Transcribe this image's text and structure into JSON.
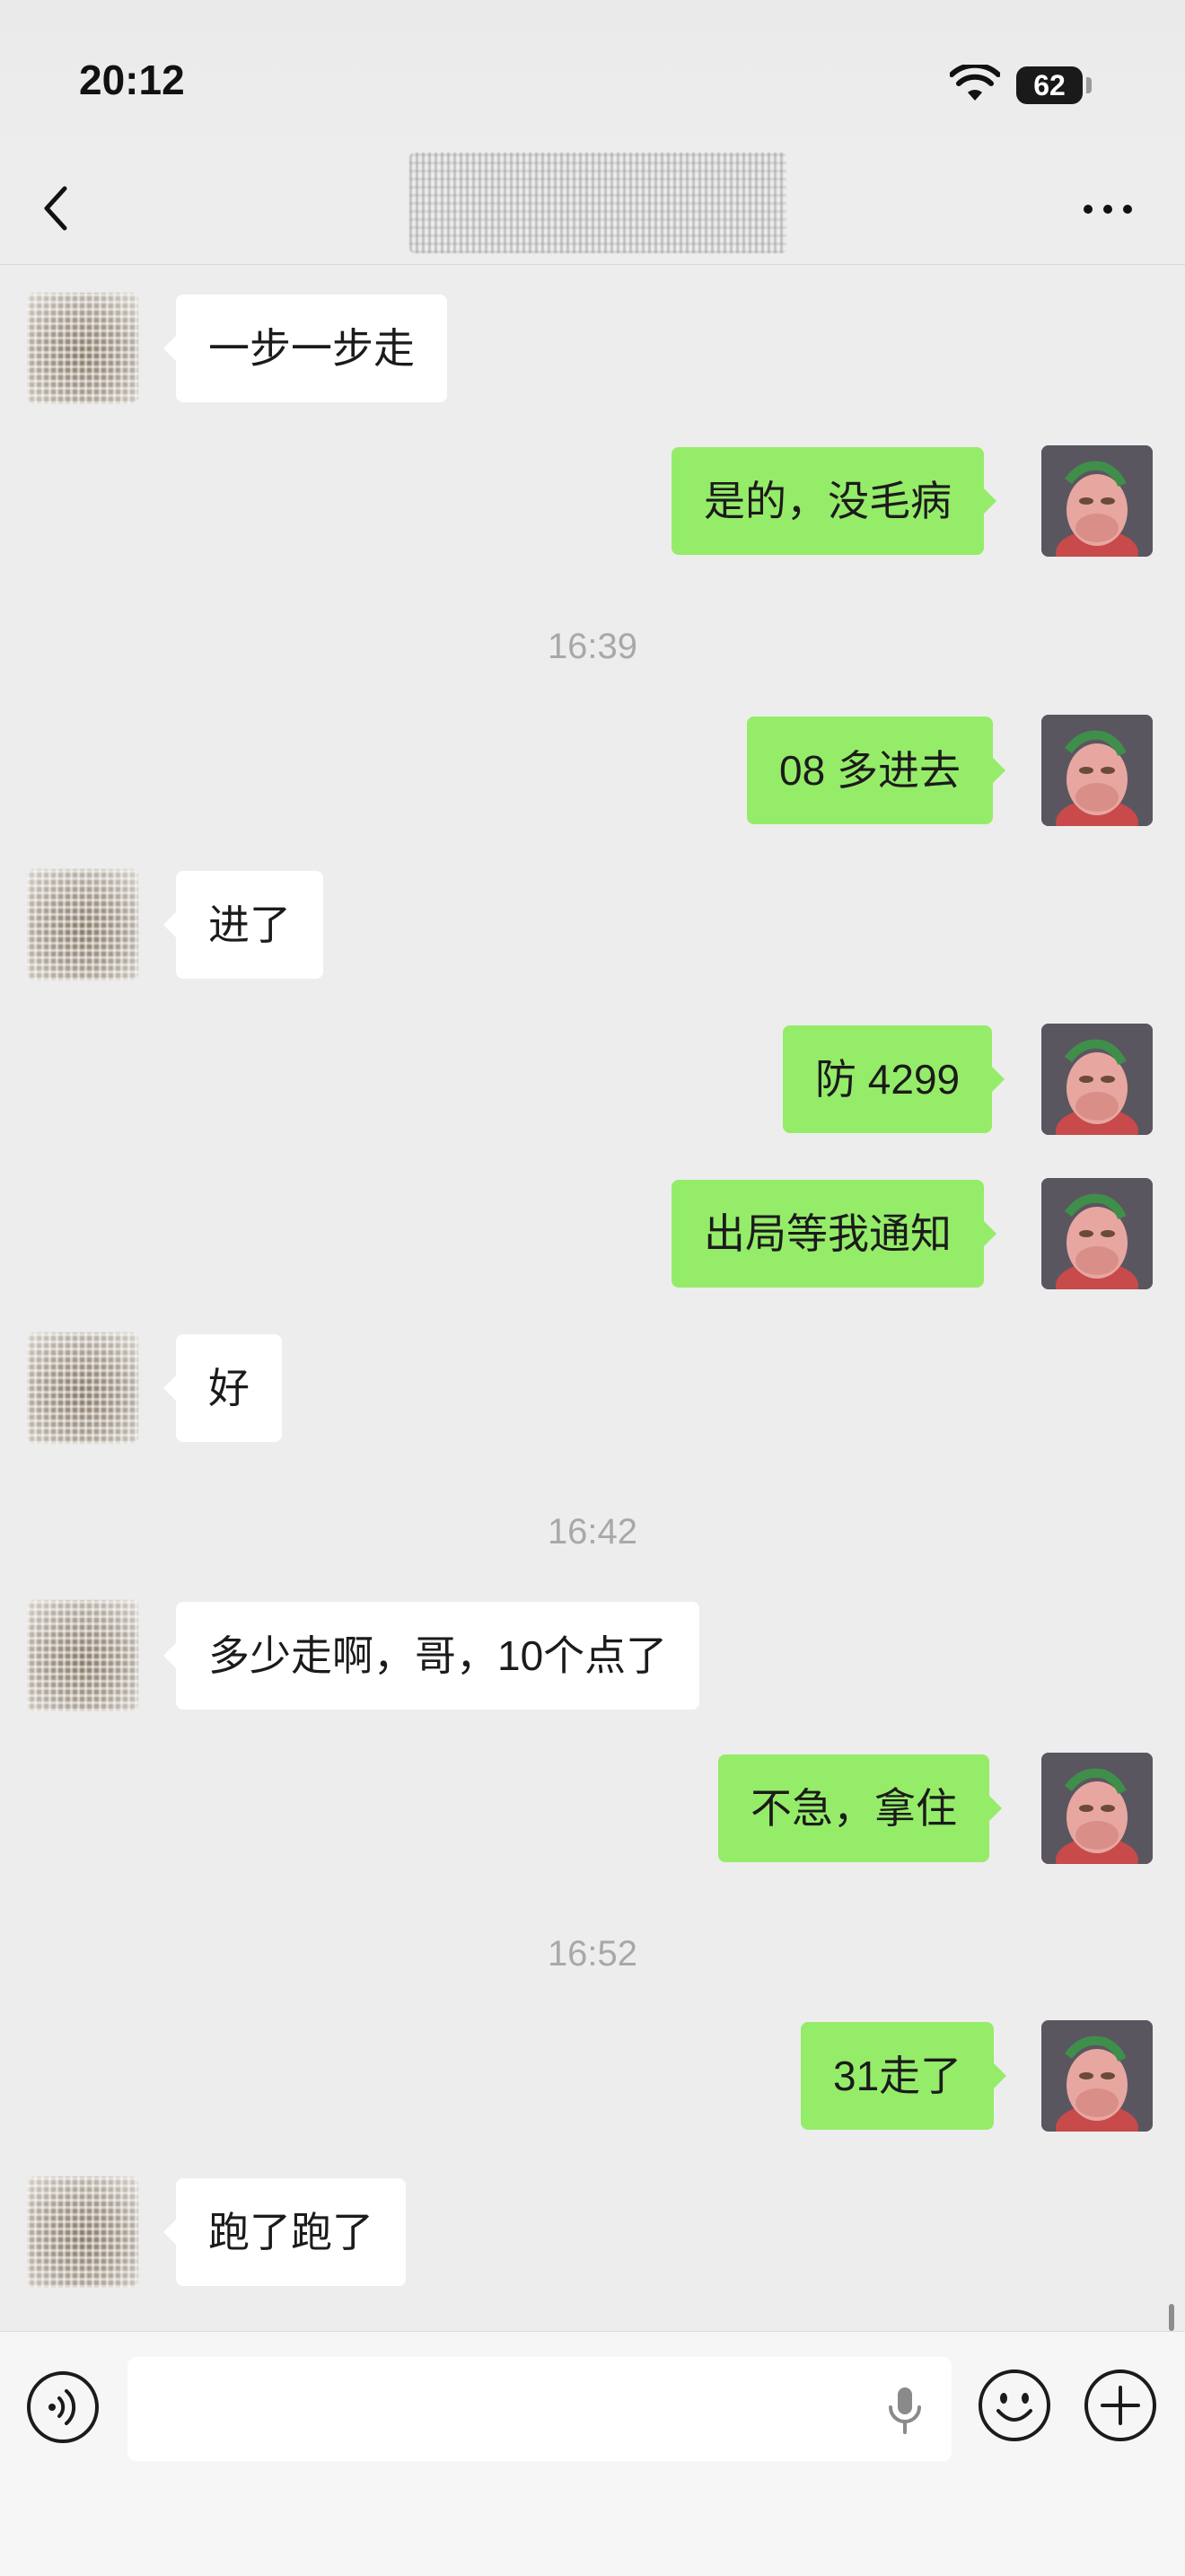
{
  "status_bar": {
    "time": "20:12",
    "battery": "62"
  },
  "nav": {
    "title": ""
  },
  "messages": [
    {
      "sender": "other",
      "text": "一步一步走"
    },
    {
      "sender": "self",
      "text": "是的，没毛病"
    },
    {
      "type": "timestamp",
      "text": "16:39"
    },
    {
      "sender": "self",
      "text": "08 多进去"
    },
    {
      "sender": "other",
      "text": "进了"
    },
    {
      "sender": "self",
      "text": "防 4299"
    },
    {
      "sender": "self",
      "text": "出局等我通知"
    },
    {
      "sender": "other",
      "text": "好"
    },
    {
      "type": "timestamp",
      "text": "16:42"
    },
    {
      "sender": "other",
      "text": "多少走啊，哥，10个点了"
    },
    {
      "sender": "self",
      "text": "不急，拿住"
    },
    {
      "type": "timestamp",
      "text": "16:52"
    },
    {
      "sender": "self",
      "text": "31走了"
    },
    {
      "sender": "other",
      "text": "跑了跑了"
    }
  ],
  "input": {
    "value": "",
    "placeholder": ""
  },
  "icons": {
    "back": "chevron-left-icon",
    "more": "more-dots-icon",
    "voice": "voice-icon",
    "mic": "microphone-icon",
    "emoji": "emoji-icon",
    "plus": "plus-icon"
  },
  "colors": {
    "self_bubble": "#95ec69",
    "other_bubble": "#ffffff",
    "background": "#ededed"
  }
}
